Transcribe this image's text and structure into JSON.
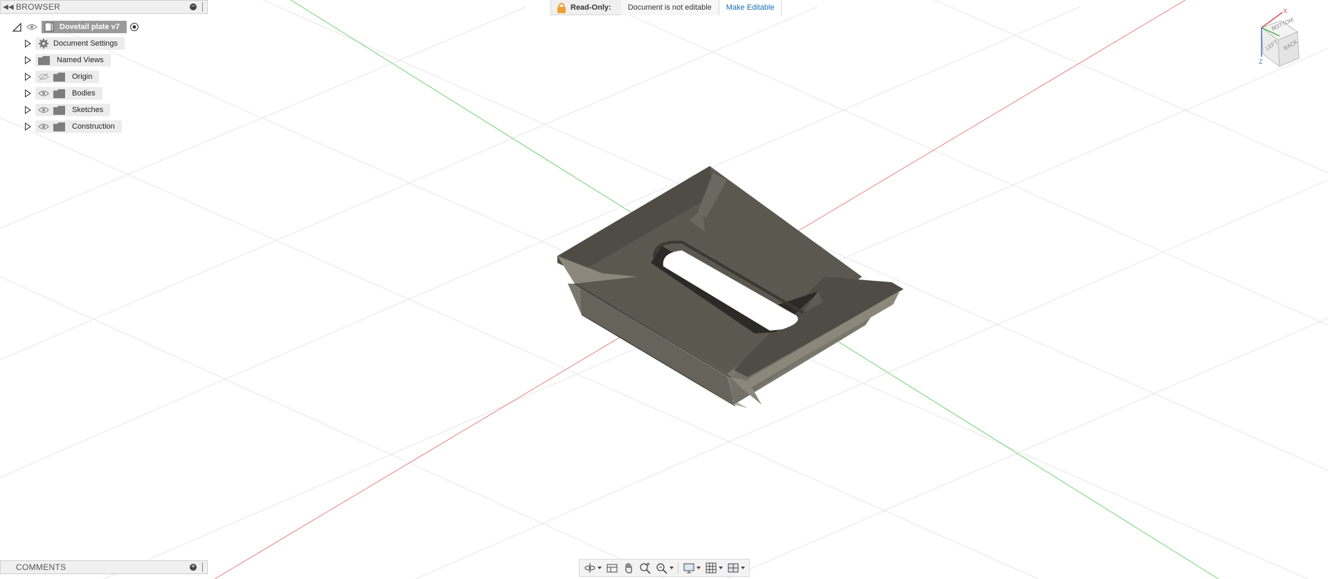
{
  "browser": {
    "title": "BROWSER",
    "root": {
      "label": "Dovetail plate v7"
    },
    "items": [
      {
        "label": "Document Settings",
        "icon": "gear-icon"
      },
      {
        "label": "Named Views",
        "icon": "folder-icon"
      },
      {
        "label": "Origin",
        "icon": "folder-icon",
        "visibility": "hidden"
      },
      {
        "label": "Bodies",
        "icon": "folder-icon",
        "visibility": "visible"
      },
      {
        "label": "Sketches",
        "icon": "folder-icon",
        "visibility": "visible"
      },
      {
        "label": "Construction",
        "icon": "folder-icon",
        "visibility": "visible"
      }
    ]
  },
  "banner": {
    "readonly_label": "Read-Only:",
    "message": "Document is not editable",
    "make_editable": "Make Editable",
    "accent": "#1a6fb5",
    "lock_color": "#f0a030"
  },
  "comments": {
    "title": "COMMENTS"
  },
  "viewcube": {
    "faces": [
      "BOTTOM",
      "LEFT",
      "BACK"
    ],
    "axes": [
      "X",
      "Y",
      "Z"
    ]
  },
  "nav_toolbar": {
    "tools": [
      "orbit-icon",
      "look-at-icon",
      "pan-icon",
      "zoom-icon",
      "zoom-window-icon",
      "display-settings-icon",
      "grid-icon",
      "viewports-icon"
    ]
  },
  "colors": {
    "x_axis": "#e88080",
    "y_axis": "#6fd06f",
    "grid": "#e6e6e6",
    "model": "#57544c"
  }
}
